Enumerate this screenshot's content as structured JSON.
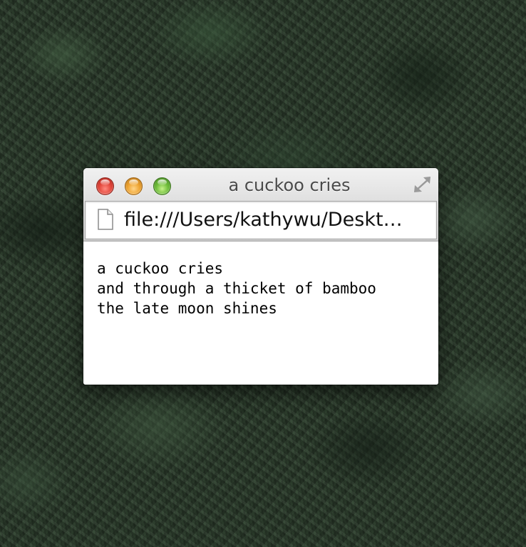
{
  "window": {
    "title": "a cuckoo cries",
    "controls": {
      "close_color": "#e2463a",
      "minimize_color": "#eea431",
      "zoom_color": "#6fbd3a"
    },
    "fullscreen_icon": "fullscreen-arrows-icon"
  },
  "address_bar": {
    "icon": "document-icon",
    "url": "file:///Users/kathywu/Deskt…"
  },
  "content": {
    "lines": [
      "a cuckoo cries",
      "and through a thicket of bamboo",
      "the late moon shines"
    ]
  }
}
